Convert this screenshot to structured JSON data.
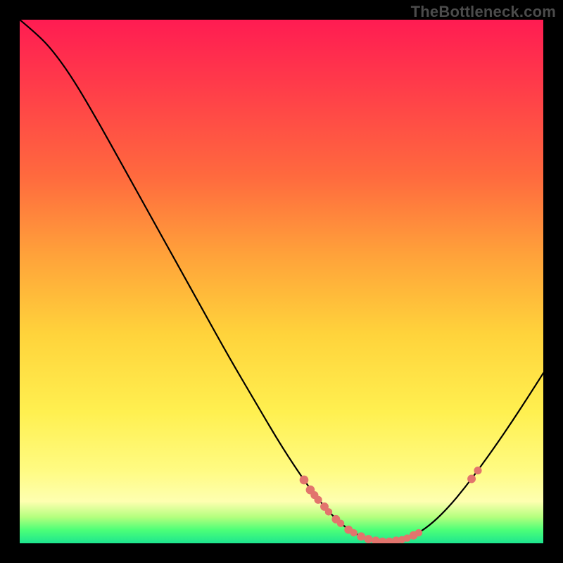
{
  "watermark": "TheBottleneck.com",
  "chart_data": {
    "type": "line",
    "title": "",
    "xlabel": "",
    "ylabel": "",
    "xlim": [
      0,
      100
    ],
    "ylim": [
      0,
      100
    ],
    "grid": false,
    "legend": false,
    "curve": [
      {
        "x": 0.0,
        "y": 100.0
      },
      {
        "x": 3.0,
        "y": 97.5
      },
      {
        "x": 6.0,
        "y": 94.5
      },
      {
        "x": 10.0,
        "y": 89.0
      },
      {
        "x": 15.0,
        "y": 80.5
      },
      {
        "x": 20.0,
        "y": 71.5
      },
      {
        "x": 25.0,
        "y": 62.5
      },
      {
        "x": 30.0,
        "y": 53.5
      },
      {
        "x": 35.0,
        "y": 44.5
      },
      {
        "x": 40.0,
        "y": 35.5
      },
      {
        "x": 45.0,
        "y": 27.0
      },
      {
        "x": 50.0,
        "y": 18.5
      },
      {
        "x": 55.0,
        "y": 11.0
      },
      {
        "x": 58.0,
        "y": 7.2
      },
      {
        "x": 61.0,
        "y": 4.0
      },
      {
        "x": 64.0,
        "y": 1.8
      },
      {
        "x": 67.0,
        "y": 0.7
      },
      {
        "x": 70.0,
        "y": 0.3
      },
      {
        "x": 73.0,
        "y": 0.6
      },
      {
        "x": 76.0,
        "y": 1.8
      },
      {
        "x": 79.0,
        "y": 4.0
      },
      {
        "x": 82.0,
        "y": 7.0
      },
      {
        "x": 85.0,
        "y": 10.6
      },
      {
        "x": 88.0,
        "y": 14.6
      },
      {
        "x": 91.0,
        "y": 18.8
      },
      {
        "x": 94.0,
        "y": 23.2
      },
      {
        "x": 97.0,
        "y": 27.8
      },
      {
        "x": 100.0,
        "y": 32.5
      }
    ],
    "markers": [
      {
        "x": 54.3,
        "y": 12.1,
        "r": 0.85
      },
      {
        "x": 55.5,
        "y": 10.2,
        "r": 0.85
      },
      {
        "x": 56.3,
        "y": 9.2,
        "r": 0.75
      },
      {
        "x": 57.0,
        "y": 8.3,
        "r": 0.75
      },
      {
        "x": 58.2,
        "y": 7.0,
        "r": 0.8
      },
      {
        "x": 59.0,
        "y": 6.0,
        "r": 0.7
      },
      {
        "x": 60.4,
        "y": 4.6,
        "r": 0.8
      },
      {
        "x": 61.3,
        "y": 3.8,
        "r": 0.7
      },
      {
        "x": 62.8,
        "y": 2.6,
        "r": 0.8
      },
      {
        "x": 63.8,
        "y": 2.0,
        "r": 0.7
      },
      {
        "x": 65.2,
        "y": 1.3,
        "r": 0.8
      },
      {
        "x": 66.6,
        "y": 0.8,
        "r": 0.8
      },
      {
        "x": 68.0,
        "y": 0.5,
        "r": 0.8
      },
      {
        "x": 69.3,
        "y": 0.3,
        "r": 0.8
      },
      {
        "x": 70.6,
        "y": 0.3,
        "r": 0.8
      },
      {
        "x": 71.9,
        "y": 0.5,
        "r": 0.8
      },
      {
        "x": 73.0,
        "y": 0.7,
        "r": 0.7
      },
      {
        "x": 74.0,
        "y": 1.0,
        "r": 0.7
      },
      {
        "x": 75.2,
        "y": 1.5,
        "r": 0.8
      },
      {
        "x": 76.2,
        "y": 2.0,
        "r": 0.7
      },
      {
        "x": 86.3,
        "y": 12.3,
        "r": 0.8
      },
      {
        "x": 87.5,
        "y": 13.9,
        "r": 0.75
      }
    ],
    "gradient_stops": [
      {
        "pos": 0.0,
        "color": "#ff1c52"
      },
      {
        "pos": 0.12,
        "color": "#ff3a4a"
      },
      {
        "pos": 0.3,
        "color": "#ff6a3e"
      },
      {
        "pos": 0.45,
        "color": "#ffa23a"
      },
      {
        "pos": 0.6,
        "color": "#ffd33b"
      },
      {
        "pos": 0.75,
        "color": "#fff050"
      },
      {
        "pos": 0.86,
        "color": "#fffb82"
      },
      {
        "pos": 0.92,
        "color": "#feffb0"
      },
      {
        "pos": 0.95,
        "color": "#b4ff7e"
      },
      {
        "pos": 0.975,
        "color": "#4bff78"
      },
      {
        "pos": 1.0,
        "color": "#1de58f"
      }
    ],
    "colors": {
      "curve": "#000000",
      "marker": "#e2746d",
      "background_frame": "#000000"
    }
  }
}
